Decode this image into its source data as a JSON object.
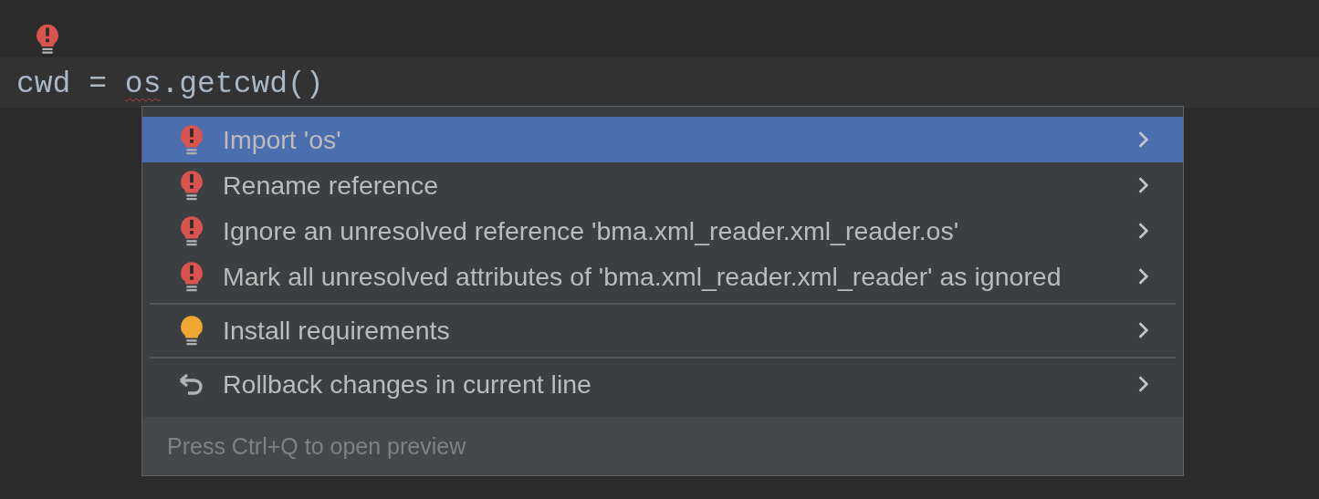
{
  "editor": {
    "gutter_icon": {
      "kind": "error-bulb"
    },
    "code_line": {
      "current": true,
      "segments": [
        {
          "text": "cwd = ",
          "error": false
        },
        {
          "text": "os",
          "error": true
        },
        {
          "text": ".getcwd()",
          "error": false
        }
      ]
    }
  },
  "popup": {
    "groups": [
      {
        "items": [
          {
            "kind": "error-bulb",
            "label": "Import 'os'",
            "selected": true,
            "submenu": true
          },
          {
            "kind": "error-bulb",
            "label": "Rename reference",
            "selected": false,
            "submenu": true
          },
          {
            "kind": "error-bulb",
            "label": "Ignore an unresolved reference 'bma.xml_reader.xml_reader.os'",
            "selected": false,
            "submenu": true
          },
          {
            "kind": "error-bulb",
            "label": "Mark all unresolved attributes of 'bma.xml_reader.xml_reader' as ignored",
            "selected": false,
            "submenu": true
          }
        ]
      },
      {
        "items": [
          {
            "kind": "bulb",
            "label": "Install requirements",
            "selected": false,
            "submenu": true
          }
        ]
      },
      {
        "items": [
          {
            "kind": "undo",
            "label": "Rollback changes in current line",
            "selected": false,
            "submenu": true
          }
        ]
      }
    ],
    "footer": "Press Ctrl+Q to open preview"
  }
}
